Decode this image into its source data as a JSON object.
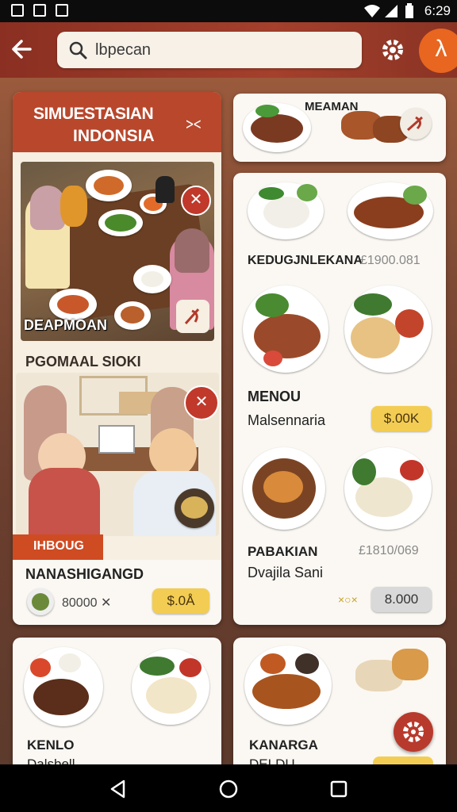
{
  "status": {
    "time": "6:29",
    "icons": [
      "photo-icon",
      "n-icon",
      "n-icon",
      "wifi-icon",
      "signal-icon",
      "battery-icon"
    ]
  },
  "header": {
    "search_text": "lbpecan",
    "avatar_glyph": "λ"
  },
  "left_card": {
    "title_line1": "SIMUESTASIAN",
    "title_line2": "INDONSIA",
    "image_caption": "DEAPMOAN",
    "section_label": "PGOMAAL SIOKI",
    "tag": "IHBOUG",
    "item_name": "NANASHIGANGD",
    "item_price": "80000 ✕",
    "price_button": "$.0Å"
  },
  "top_right_card": {
    "label": "MEAMAN"
  },
  "menu_card": {
    "row1_name": "KEDUGJNLEKANA",
    "row1_price": "£1900.081",
    "row2_title": "MENOU",
    "row2_sub": "Malsennaria",
    "row2_button": "$.00K",
    "row3_title": "PABAKIAN",
    "row3_price": "£1810/069",
    "row3_sub": "Dvajila Sani",
    "row3_marks": "×○×",
    "row3_button": "8.000"
  },
  "bottom_left_card": {
    "title": "KENLO",
    "sub": "Dalsbell"
  },
  "bottom_right_card": {
    "title": "KANARGA",
    "sub": "DELDU"
  },
  "colors": {
    "header": "#a4402c",
    "accent": "#e8661f",
    "tag": "#cf4b22",
    "button_yellow": "#f3cd53"
  }
}
